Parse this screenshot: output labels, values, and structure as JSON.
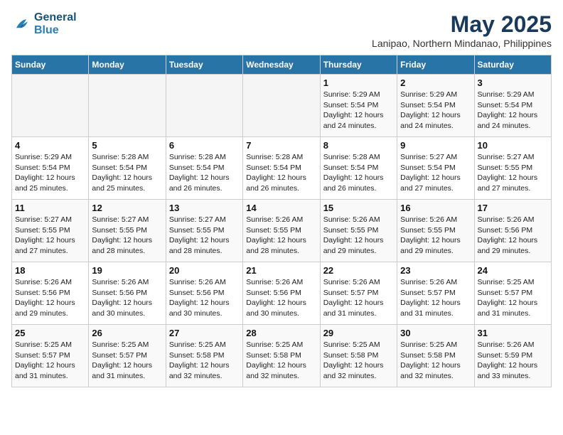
{
  "header": {
    "logo_line1": "General",
    "logo_line2": "Blue",
    "month": "May 2025",
    "location": "Lanipao, Northern Mindanao, Philippines"
  },
  "weekdays": [
    "Sunday",
    "Monday",
    "Tuesday",
    "Wednesday",
    "Thursday",
    "Friday",
    "Saturday"
  ],
  "weeks": [
    [
      {
        "day": "",
        "info": ""
      },
      {
        "day": "",
        "info": ""
      },
      {
        "day": "",
        "info": ""
      },
      {
        "day": "",
        "info": ""
      },
      {
        "day": "1",
        "info": "Sunrise: 5:29 AM\nSunset: 5:54 PM\nDaylight: 12 hours\nand 24 minutes."
      },
      {
        "day": "2",
        "info": "Sunrise: 5:29 AM\nSunset: 5:54 PM\nDaylight: 12 hours\nand 24 minutes."
      },
      {
        "day": "3",
        "info": "Sunrise: 5:29 AM\nSunset: 5:54 PM\nDaylight: 12 hours\nand 24 minutes."
      }
    ],
    [
      {
        "day": "4",
        "info": "Sunrise: 5:29 AM\nSunset: 5:54 PM\nDaylight: 12 hours\nand 25 minutes."
      },
      {
        "day": "5",
        "info": "Sunrise: 5:28 AM\nSunset: 5:54 PM\nDaylight: 12 hours\nand 25 minutes."
      },
      {
        "day": "6",
        "info": "Sunrise: 5:28 AM\nSunset: 5:54 PM\nDaylight: 12 hours\nand 26 minutes."
      },
      {
        "day": "7",
        "info": "Sunrise: 5:28 AM\nSunset: 5:54 PM\nDaylight: 12 hours\nand 26 minutes."
      },
      {
        "day": "8",
        "info": "Sunrise: 5:28 AM\nSunset: 5:54 PM\nDaylight: 12 hours\nand 26 minutes."
      },
      {
        "day": "9",
        "info": "Sunrise: 5:27 AM\nSunset: 5:54 PM\nDaylight: 12 hours\nand 27 minutes."
      },
      {
        "day": "10",
        "info": "Sunrise: 5:27 AM\nSunset: 5:55 PM\nDaylight: 12 hours\nand 27 minutes."
      }
    ],
    [
      {
        "day": "11",
        "info": "Sunrise: 5:27 AM\nSunset: 5:55 PM\nDaylight: 12 hours\nand 27 minutes."
      },
      {
        "day": "12",
        "info": "Sunrise: 5:27 AM\nSunset: 5:55 PM\nDaylight: 12 hours\nand 28 minutes."
      },
      {
        "day": "13",
        "info": "Sunrise: 5:27 AM\nSunset: 5:55 PM\nDaylight: 12 hours\nand 28 minutes."
      },
      {
        "day": "14",
        "info": "Sunrise: 5:26 AM\nSunset: 5:55 PM\nDaylight: 12 hours\nand 28 minutes."
      },
      {
        "day": "15",
        "info": "Sunrise: 5:26 AM\nSunset: 5:55 PM\nDaylight: 12 hours\nand 29 minutes."
      },
      {
        "day": "16",
        "info": "Sunrise: 5:26 AM\nSunset: 5:55 PM\nDaylight: 12 hours\nand 29 minutes."
      },
      {
        "day": "17",
        "info": "Sunrise: 5:26 AM\nSunset: 5:56 PM\nDaylight: 12 hours\nand 29 minutes."
      }
    ],
    [
      {
        "day": "18",
        "info": "Sunrise: 5:26 AM\nSunset: 5:56 PM\nDaylight: 12 hours\nand 29 minutes."
      },
      {
        "day": "19",
        "info": "Sunrise: 5:26 AM\nSunset: 5:56 PM\nDaylight: 12 hours\nand 30 minutes."
      },
      {
        "day": "20",
        "info": "Sunrise: 5:26 AM\nSunset: 5:56 PM\nDaylight: 12 hours\nand 30 minutes."
      },
      {
        "day": "21",
        "info": "Sunrise: 5:26 AM\nSunset: 5:56 PM\nDaylight: 12 hours\nand 30 minutes."
      },
      {
        "day": "22",
        "info": "Sunrise: 5:26 AM\nSunset: 5:57 PM\nDaylight: 12 hours\nand 31 minutes."
      },
      {
        "day": "23",
        "info": "Sunrise: 5:26 AM\nSunset: 5:57 PM\nDaylight: 12 hours\nand 31 minutes."
      },
      {
        "day": "24",
        "info": "Sunrise: 5:25 AM\nSunset: 5:57 PM\nDaylight: 12 hours\nand 31 minutes."
      }
    ],
    [
      {
        "day": "25",
        "info": "Sunrise: 5:25 AM\nSunset: 5:57 PM\nDaylight: 12 hours\nand 31 minutes."
      },
      {
        "day": "26",
        "info": "Sunrise: 5:25 AM\nSunset: 5:57 PM\nDaylight: 12 hours\nand 31 minutes."
      },
      {
        "day": "27",
        "info": "Sunrise: 5:25 AM\nSunset: 5:58 PM\nDaylight: 12 hours\nand 32 minutes."
      },
      {
        "day": "28",
        "info": "Sunrise: 5:25 AM\nSunset: 5:58 PM\nDaylight: 12 hours\nand 32 minutes."
      },
      {
        "day": "29",
        "info": "Sunrise: 5:25 AM\nSunset: 5:58 PM\nDaylight: 12 hours\nand 32 minutes."
      },
      {
        "day": "30",
        "info": "Sunrise: 5:25 AM\nSunset: 5:58 PM\nDaylight: 12 hours\nand 32 minutes."
      },
      {
        "day": "31",
        "info": "Sunrise: 5:26 AM\nSunset: 5:59 PM\nDaylight: 12 hours\nand 33 minutes."
      }
    ]
  ]
}
